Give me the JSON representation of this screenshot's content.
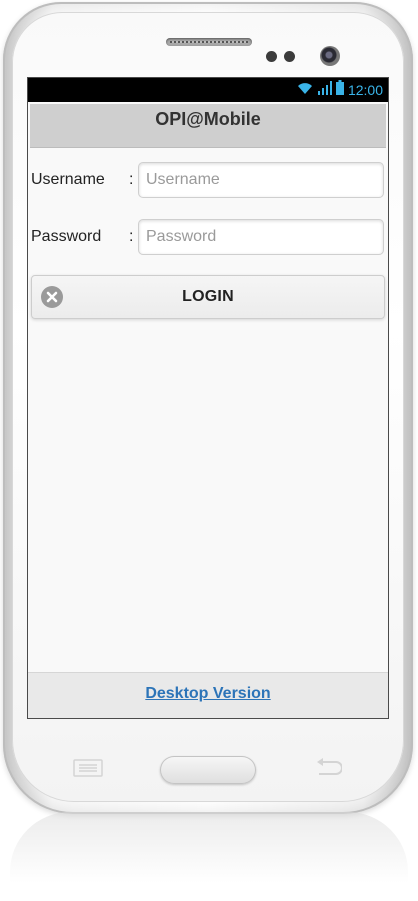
{
  "status_bar": {
    "time": "12:00"
  },
  "header": {
    "title": "OPI@Mobile"
  },
  "form": {
    "username": {
      "label": "Username",
      "colon": ":",
      "placeholder": "Username",
      "value": ""
    },
    "password": {
      "label": "Password",
      "colon": ":",
      "placeholder": "Password",
      "value": ""
    }
  },
  "login_button": {
    "label": "LOGIN",
    "icon": "close-circle-icon"
  },
  "footer": {
    "link_label": "Desktop Version"
  },
  "colors": {
    "link": "#2c74b8",
    "status_icons": "#3ab4e8",
    "header_bg": "#cfcfcf",
    "footer_bg": "#e9e9e9"
  }
}
